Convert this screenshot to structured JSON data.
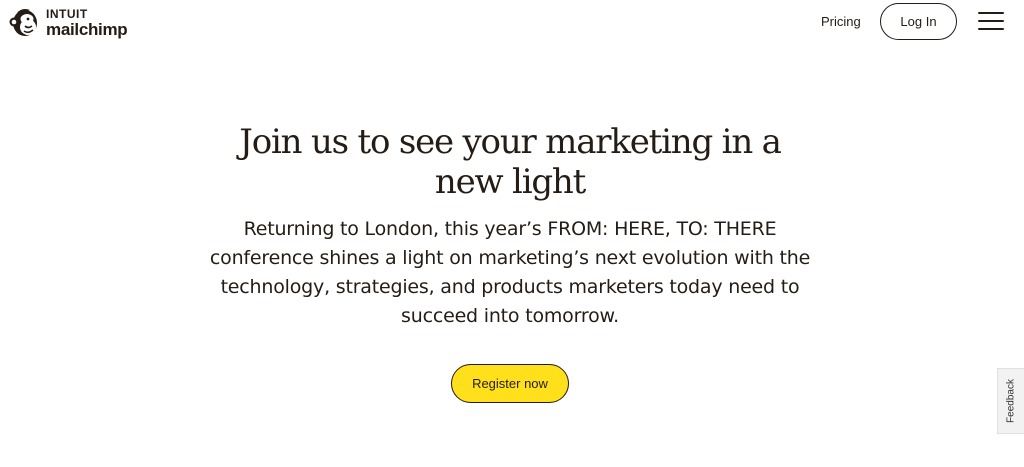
{
  "header": {
    "logo": {
      "brand_top": "INTUIT",
      "brand_main": "mailchimp",
      "icon": "freddie-chimp-logo-icon"
    },
    "nav": {
      "pricing_label": "Pricing",
      "login_label": "Log In",
      "menu_icon": "hamburger-menu-icon"
    }
  },
  "hero": {
    "title_line1": "Join us to see your marketing in a",
    "title_line2": "new light",
    "body": "Returning to London, this year’s FROM: HERE, TO: THERE conference shines a light on marketing’s next evolution with the technology, strategies, and products marketers today need to succeed into tomorrow.",
    "cta_label": "Register now"
  },
  "feedback": {
    "label": "Feedback"
  },
  "colors": {
    "text": "#241c15",
    "cta_background": "#ffe01b",
    "background": "#ffffff",
    "feedback_background": "#f2f2f2"
  }
}
